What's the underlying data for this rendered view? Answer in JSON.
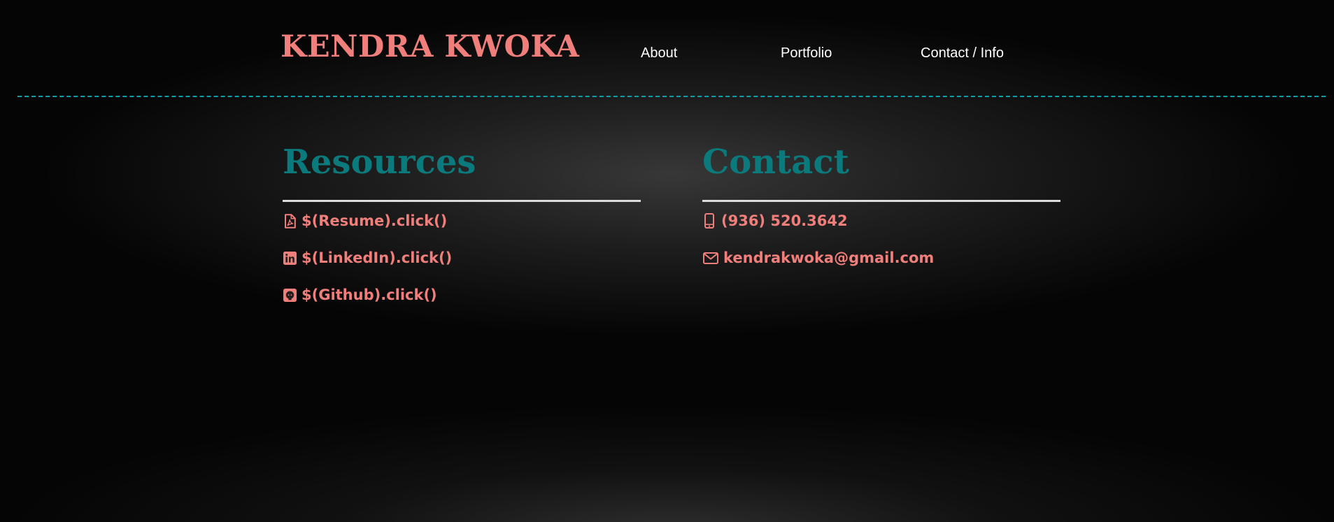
{
  "header": {
    "brand": "KENDRA KWOKA",
    "nav": {
      "about": "About",
      "portfolio": "Portfolio",
      "contact": "Contact / Info"
    }
  },
  "resources": {
    "title": "Resources",
    "items": [
      {
        "label": "$(Resume).click()",
        "icon": "file-pdf-icon"
      },
      {
        "label": "$(LinkedIn).click()",
        "icon": "linkedin-icon"
      },
      {
        "label": "$(Github).click()",
        "icon": "github-icon"
      }
    ]
  },
  "contact": {
    "title": "Contact",
    "items": [
      {
        "label": "(936) 520.3642",
        "icon": "mobile-phone-icon"
      },
      {
        "label": "kendrakwoka@gmail.com",
        "icon": "envelope-icon"
      }
    ]
  },
  "colors": {
    "accent_salmon": "#f07f7c",
    "accent_teal": "#0b7a7c",
    "divider_teal": "#0c9fa8",
    "rule": "#dcdcdc",
    "background": "#050505"
  }
}
